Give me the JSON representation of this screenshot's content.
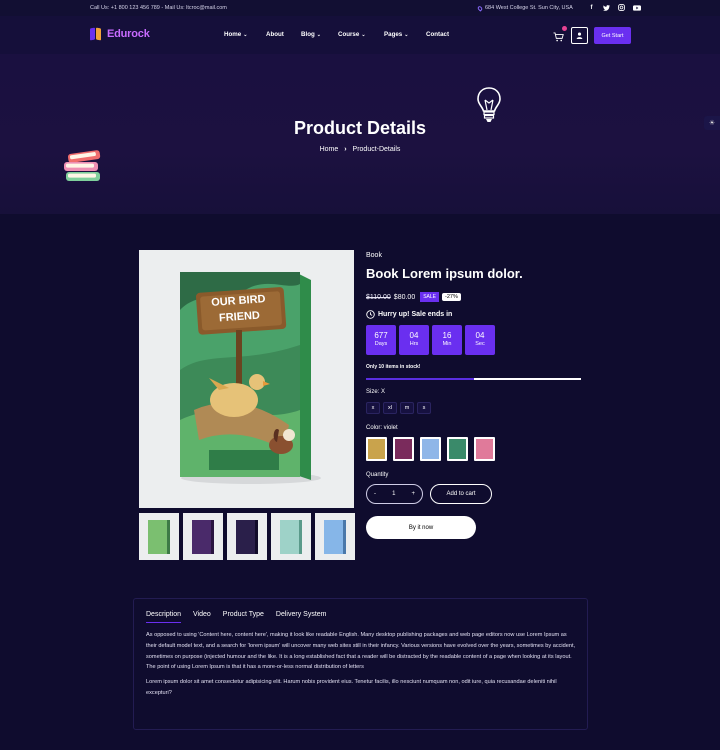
{
  "topbar": {
    "contact": "Call Us: +1 800 123 456 789 - Mail Us: ltcroc@mail.com",
    "address": "684 West College St. Sun City, USA",
    "socials": [
      "facebook-icon",
      "twitter-icon",
      "instagram-icon",
      "youtube-icon"
    ]
  },
  "header": {
    "brand": "Edurock",
    "nav": [
      {
        "label": "Home",
        "dropdown": true
      },
      {
        "label": "About",
        "dropdown": false
      },
      {
        "label": "Blog",
        "dropdown": true
      },
      {
        "label": "Course",
        "dropdown": true
      },
      {
        "label": "Pages",
        "dropdown": true
      },
      {
        "label": "Contact",
        "dropdown": false
      }
    ],
    "cta": "Get Start"
  },
  "hero": {
    "title": "Product Details",
    "breadcrumb": [
      "Home",
      "Product-Details"
    ]
  },
  "product": {
    "category": "Book",
    "title": "Book Lorem ipsum dolor.",
    "old_price": "$110.00",
    "price": "$80.00",
    "sale_badge": "SALE",
    "discount": "-27%",
    "hurry_text": "Hurry up! Sale ends in",
    "countdown": [
      {
        "value": "677",
        "unit": "Days"
      },
      {
        "value": "04",
        "unit": "Hrs"
      },
      {
        "value": "16",
        "unit": "Min"
      },
      {
        "value": "04",
        "unit": "Sec"
      }
    ],
    "stock_text": "Only 10 items in stock!",
    "stock_fraction": 0.5,
    "size_label": "Size: X",
    "sizes": [
      "x",
      "xl",
      "m",
      "s"
    ],
    "color_label": "Color: violet",
    "color_swatches": [
      "#c9a34c",
      "#7a2b5c",
      "#8fb6e8",
      "#3a8a6a",
      "#e07a9a"
    ],
    "quantity_label": "Quantity",
    "quantity": "1",
    "add_to_cart": "Add to cart",
    "buy_now": "By it now",
    "cover_title_lines": [
      "OUR BIRD",
      "FRIEND"
    ],
    "thumbnails": [
      "#7bbf70",
      "#4a2a6a",
      "#2a1f4a",
      "#9ed2c8",
      "#86b6e8"
    ]
  },
  "tabs": {
    "items": [
      "Description",
      "Video",
      "Product Type",
      "Delivery System"
    ],
    "active": "Description",
    "paragraphs": [
      "As opposed to using 'Content here, content here', making it look like readable English. Many desktop publishing packages and web page editors now use Lorem Ipsum as their default model text, and a search for 'lorem ipsum' will uncover many web sites still in their infancy. Various versions have evolved over the years, sometimes by accident, sometimes on purpose (injected humour and the like. It is a long established fact that a reader will be distracted by the readable content of a page when looking at its layout. The point of using Lorem Ipsum is that it has a more-or-less normal distribution of letters",
      "Lorem ipsum dolor sit amet consectetur adipisicing elit. Harum nobis provident eius. Tenetur facilis, illo nesciunt numquam non, odit iure, quia recusandae deleniti nihil excepturi?"
    ]
  },
  "colors": {
    "accent": "#6a2ff0",
    "background": "#0f0c2e",
    "hero": "#1c1140"
  }
}
